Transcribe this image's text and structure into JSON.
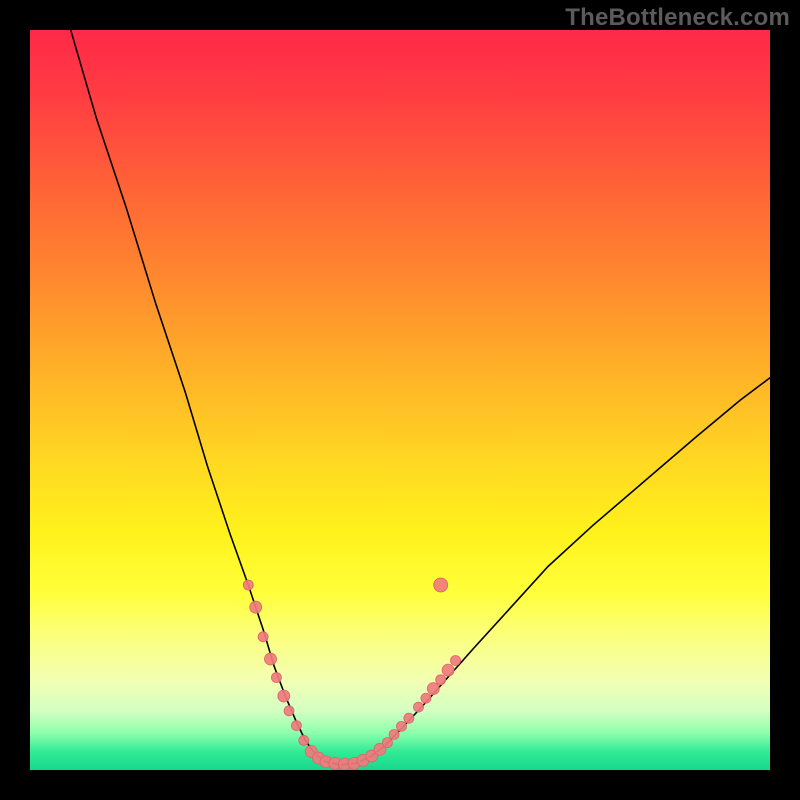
{
  "watermark": "TheBottleneck.com",
  "colors": {
    "background": "#000000",
    "curve_stroke": "#000000",
    "marker_fill": "#f07b7d",
    "marker_stroke": "#d96567"
  },
  "chart_data": {
    "type": "line",
    "title": "",
    "xlabel": "",
    "ylabel": "",
    "xlim": [
      0,
      100
    ],
    "ylim": [
      0,
      100
    ],
    "grid": false,
    "legend": false,
    "curve_points": [
      {
        "x": 5.5,
        "y": 100
      },
      {
        "x": 9,
        "y": 88
      },
      {
        "x": 13,
        "y": 76
      },
      {
        "x": 17,
        "y": 63
      },
      {
        "x": 21,
        "y": 51
      },
      {
        "x": 24,
        "y": 41
      },
      {
        "x": 27,
        "y": 32
      },
      {
        "x": 29.5,
        "y": 25
      },
      {
        "x": 31.5,
        "y": 19
      },
      {
        "x": 33,
        "y": 14
      },
      {
        "x": 34.5,
        "y": 10
      },
      {
        "x": 36,
        "y": 6.5
      },
      {
        "x": 37.2,
        "y": 4
      },
      {
        "x": 38.5,
        "y": 2.2
      },
      {
        "x": 40,
        "y": 1.1
      },
      {
        "x": 42,
        "y": 0.7
      },
      {
        "x": 44,
        "y": 0.9
      },
      {
        "x": 46,
        "y": 1.8
      },
      {
        "x": 48,
        "y": 3.3
      },
      {
        "x": 50,
        "y": 5.4
      },
      {
        "x": 53,
        "y": 8.6
      },
      {
        "x": 56,
        "y": 12
      },
      {
        "x": 60,
        "y": 16.5
      },
      {
        "x": 65,
        "y": 22
      },
      {
        "x": 70,
        "y": 27.5
      },
      {
        "x": 76,
        "y": 33
      },
      {
        "x": 83,
        "y": 39
      },
      {
        "x": 90,
        "y": 45
      },
      {
        "x": 96,
        "y": 50
      },
      {
        "x": 100,
        "y": 53
      }
    ],
    "series": [
      {
        "name": "scatter-markers",
        "type": "scatter",
        "points": [
          {
            "x": 29.5,
            "y": 25,
            "r": 5
          },
          {
            "x": 30.5,
            "y": 22,
            "r": 6
          },
          {
            "x": 31.5,
            "y": 18,
            "r": 5
          },
          {
            "x": 32.5,
            "y": 15,
            "r": 6
          },
          {
            "x": 33.3,
            "y": 12.5,
            "r": 5
          },
          {
            "x": 34.3,
            "y": 10,
            "r": 6
          },
          {
            "x": 35,
            "y": 8,
            "r": 5
          },
          {
            "x": 36,
            "y": 6,
            "r": 5
          },
          {
            "x": 37,
            "y": 4,
            "r": 5
          },
          {
            "x": 38,
            "y": 2.5,
            "r": 6
          },
          {
            "x": 39,
            "y": 1.6,
            "r": 6
          },
          {
            "x": 40,
            "y": 1.1,
            "r": 6
          },
          {
            "x": 41.2,
            "y": 0.9,
            "r": 6
          },
          {
            "x": 42.5,
            "y": 0.8,
            "r": 6
          },
          {
            "x": 43.8,
            "y": 0.9,
            "r": 6
          },
          {
            "x": 45,
            "y": 1.3,
            "r": 6
          },
          {
            "x": 46.2,
            "y": 1.9,
            "r": 6
          },
          {
            "x": 47.3,
            "y": 2.8,
            "r": 6
          },
          {
            "x": 48.3,
            "y": 3.7,
            "r": 5
          },
          {
            "x": 49.2,
            "y": 4.8,
            "r": 5
          },
          {
            "x": 50.2,
            "y": 5.9,
            "r": 5
          },
          {
            "x": 51.2,
            "y": 7,
            "r": 5
          },
          {
            "x": 52.5,
            "y": 8.5,
            "r": 5
          },
          {
            "x": 53.5,
            "y": 9.7,
            "r": 5
          },
          {
            "x": 54.5,
            "y": 11,
            "r": 6
          },
          {
            "x": 55.5,
            "y": 12.2,
            "r": 5
          },
          {
            "x": 56.5,
            "y": 13.5,
            "r": 6
          },
          {
            "x": 57.5,
            "y": 14.8,
            "r": 5
          },
          {
            "x": 55.5,
            "y": 25,
            "r": 7
          }
        ]
      }
    ]
  }
}
